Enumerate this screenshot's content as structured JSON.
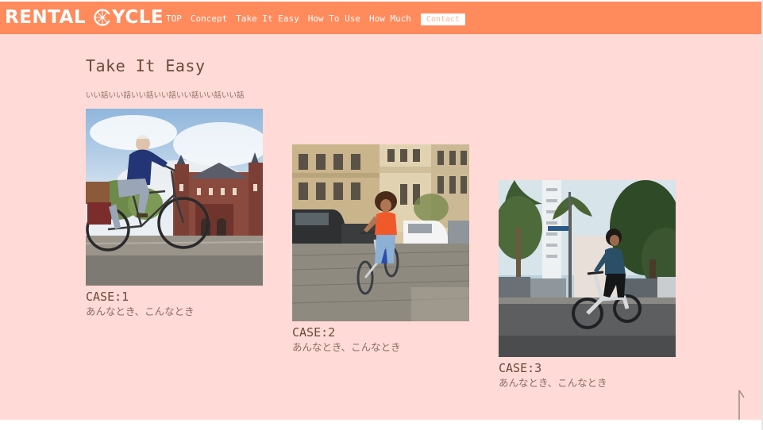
{
  "brand": {
    "word1": "RENTAL",
    "word2": "YCLE",
    "wheel_icon": "bicycle-wheel-icon"
  },
  "nav": {
    "items": [
      "TOP",
      "Concept",
      "Take It Easy",
      "How To Use",
      "How Much"
    ],
    "contact_label": "Contact"
  },
  "section": {
    "title": "Take It Easy",
    "lead": "いい話いい話いい話いい話いい話いい話いい話"
  },
  "cases": [
    {
      "title": "CASE:1",
      "text": "あんなとき、こんなとき",
      "photo": "senior-man-cycling-photo"
    },
    {
      "title": "CASE:2",
      "text": "あんなとき、こんなとき",
      "photo": "woman-riding-ebike-street-photo"
    },
    {
      "title": "CASE:3",
      "text": "あんなとき、こんなとき",
      "photo": "woman-riding-ebike-city-photo"
    }
  ],
  "scroll_top_icon": "arrow-up-icon",
  "colors": {
    "header": "#ff8a5c",
    "background": "#ffdad6",
    "text": "#6b4a3a"
  }
}
